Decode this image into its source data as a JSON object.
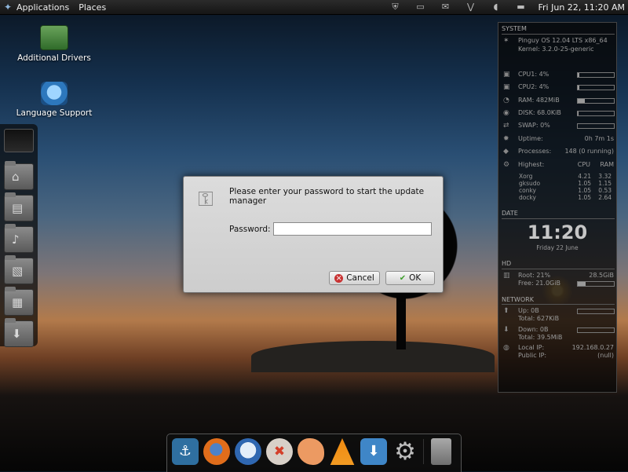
{
  "top_panel": {
    "menu": [
      "Applications",
      "Places"
    ],
    "clock": "Fri Jun 22, 11:20 AM"
  },
  "desktop_icons": [
    {
      "label": "Additional Drivers"
    },
    {
      "label": "Language Support"
    }
  ],
  "dialog": {
    "message": "Please enter your password to start the update manager",
    "password_label": "Password:",
    "password_value": "",
    "cancel_label": "Cancel",
    "ok_label": "OK"
  },
  "conky": {
    "system_title": "SYSTEM",
    "os": "Pinguy OS 12.04 LTS x86_64",
    "kernel": "Kernel: 3.2.0-25-generic",
    "cpu1": {
      "label": "CPU1: 4%",
      "fill": 0.04
    },
    "cpu2": {
      "label": "CPU2: 4%",
      "fill": 0.04
    },
    "ram": {
      "label": "RAM: 482MiB",
      "fill": 0.2
    },
    "disk": {
      "label": "DISK: 68.0KiB",
      "fill": 0.01
    },
    "swap": {
      "label": "SWAP: 0%",
      "fill": 0
    },
    "uptime_label": "Uptime:",
    "uptime_value": "0h 7m 1s",
    "processes_label": "Processes:",
    "processes_value": "148 (0 running)",
    "highest_label": "Highest:",
    "highest_cpu": "CPU",
    "highest_ram": "RAM",
    "procs": [
      {
        "name": "Xorg",
        "cpu": "4.21",
        "ram": "3.32"
      },
      {
        "name": "gksudo",
        "cpu": "1.05",
        "ram": "1.15"
      },
      {
        "name": "conky",
        "cpu": "1.05",
        "ram": "0.53"
      },
      {
        "name": "docky",
        "cpu": "1.05",
        "ram": "2.64"
      }
    ],
    "date_title": "DATE",
    "time": "11:20",
    "date": "Friday 22 June",
    "hd_title": "HD",
    "root_label": "Root: 21%",
    "root_value": "28.5GiB",
    "free_label": "Free: 21.0GiB",
    "hd_fill": 0.21,
    "network_title": "NETWORK",
    "up_label": "Up: 0B",
    "up_total": "Total: 627KiB",
    "down_label": "Down: 0B",
    "down_total": "Total: 39.5MiB",
    "local_ip_label": "Local IP:",
    "local_ip_value": "192.168.0.27",
    "public_ip_label": "Public IP:",
    "public_ip_value": "(null)"
  }
}
